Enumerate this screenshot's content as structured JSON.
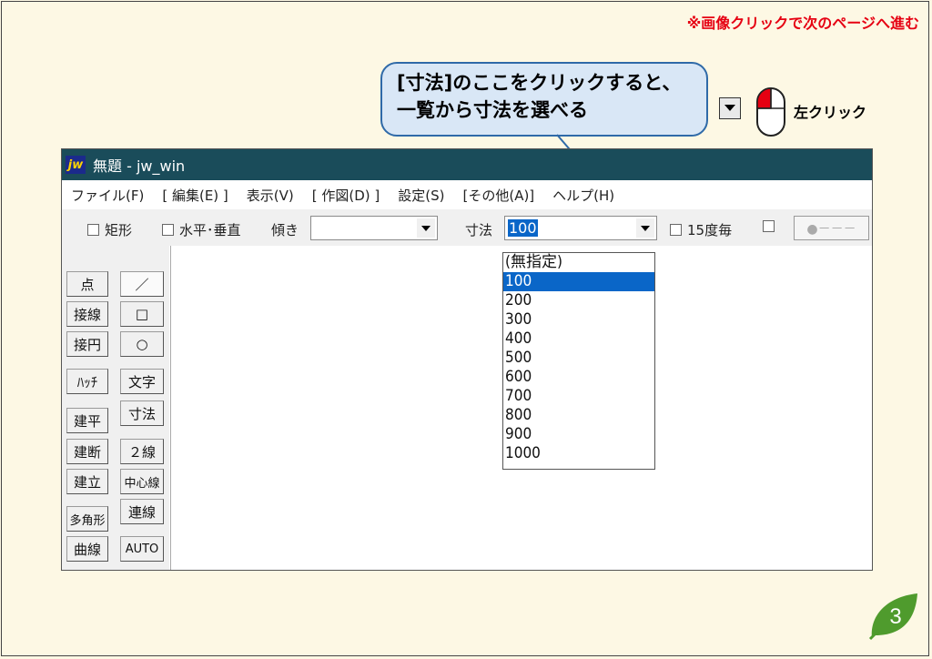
{
  "top_note": "※画像クリックで次のページへ進む",
  "callout": {
    "line1": "[寸法]のここをクリックすると、",
    "line2": "一覧から寸法を選べる"
  },
  "legend": {
    "label": "左クリック"
  },
  "window": {
    "title": "無題 - jw_win",
    "icon_text": "jw",
    "menu": [
      "ファイル(F)",
      "[ 編集(E) ]",
      "表示(V)",
      "[ 作図(D) ]",
      "設定(S)",
      "[その他(A)]",
      "ヘルプ(H)"
    ],
    "toolbar": {
      "rect_label": "矩形",
      "hv_label": "水平･垂直",
      "tilt_label": "傾き",
      "tilt_value": "",
      "dim_label": "寸法",
      "dim_value": "100",
      "deg_label": "15度毎",
      "btn_label": "●－－－"
    },
    "tools_left": [
      "点",
      "接線",
      "接円",
      "ﾊｯﾁ",
      "建平",
      "建断",
      "建立",
      "多角形",
      "曲線"
    ],
    "tools_right": [
      "／",
      "□",
      "○",
      "文字",
      "寸法",
      "２線",
      "中心線",
      "連線",
      "AUTO"
    ],
    "dropdown_options": [
      "(無指定)",
      "100",
      "200",
      "300",
      "400",
      "500",
      "600",
      "700",
      "800",
      "900",
      "1000"
    ],
    "selected_index": 1
  },
  "page_number": "3",
  "colors": {
    "titlebar": "#1a4c5a",
    "selection": "#0a66c8",
    "note_red": "#e60012",
    "page_leaf": "#4f9b2d"
  }
}
